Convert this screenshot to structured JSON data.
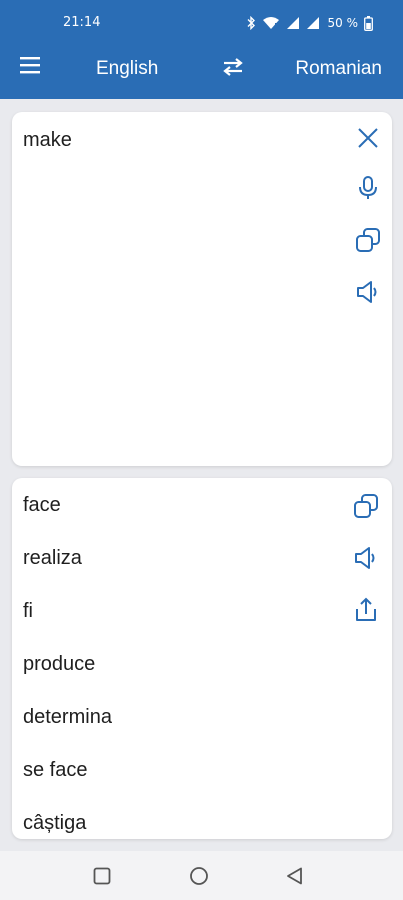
{
  "status": {
    "time": "21:14",
    "battery_text": "50 %",
    "icons": [
      "bluetooth-icon",
      "wifi-icon",
      "signal-icon",
      "signal-icon",
      "battery-icon"
    ]
  },
  "header": {
    "menu_icon": "menu-icon",
    "source_language": "English",
    "swap_icon": "swap-icon",
    "target_language": "Romanian"
  },
  "input": {
    "text": "make",
    "actions": [
      "close-icon",
      "microphone-icon",
      "copy-icon",
      "speaker-icon"
    ]
  },
  "output": {
    "results": [
      "face",
      "realiza",
      "fi",
      "produce",
      "determina",
      "se face",
      "câștiga"
    ],
    "actions": [
      "copy-icon",
      "speaker-icon",
      "share-icon"
    ]
  },
  "nav": {
    "icons": [
      "recents-square-icon",
      "home-circle-icon",
      "back-triangle-icon"
    ]
  },
  "colors": {
    "primary": "#2a6db5",
    "background": "#e9eaee",
    "card": "#ffffff",
    "text": "#1f1f1f",
    "icon": "#2a6db5"
  }
}
